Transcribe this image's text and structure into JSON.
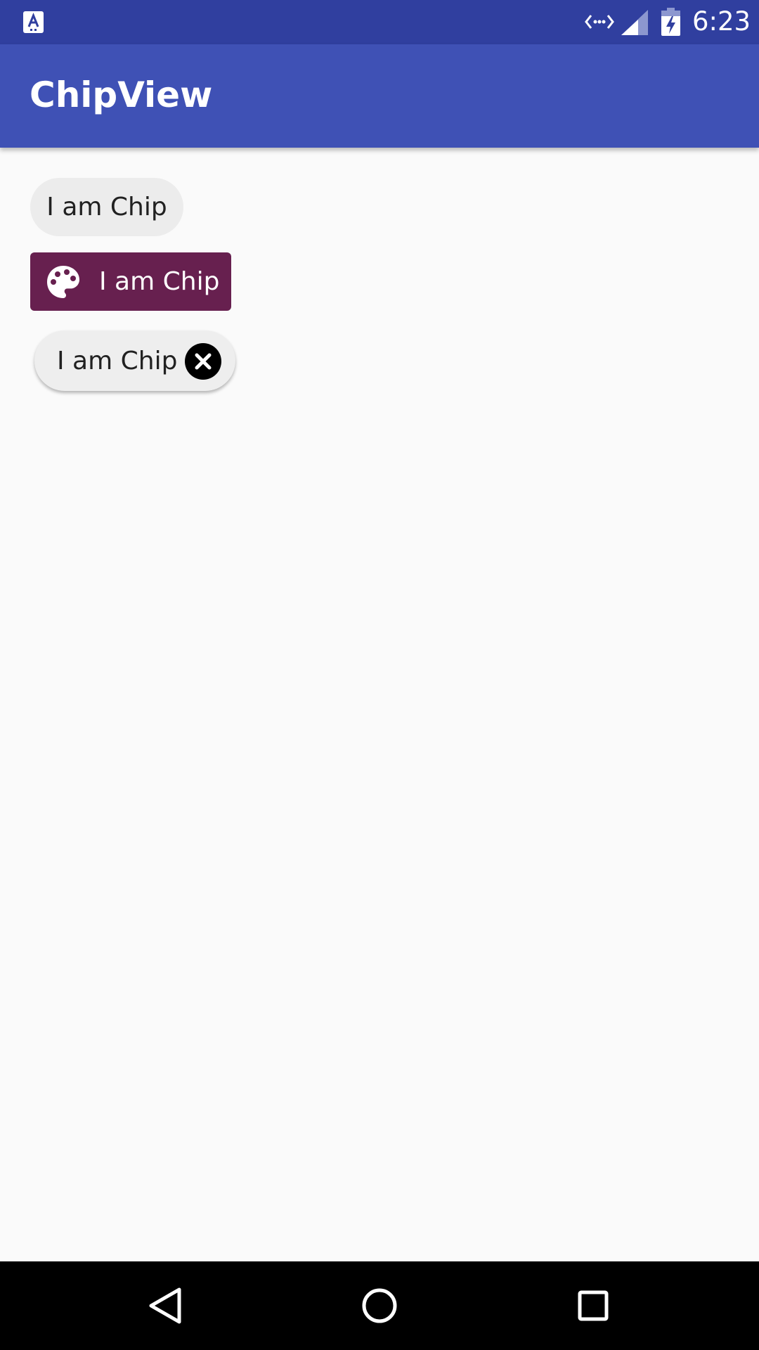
{
  "status_bar": {
    "time": "6:23",
    "icons": [
      "accessibility-a-icon",
      "data-sync-icon",
      "signal-icon",
      "battery-charging-icon"
    ],
    "background": "#303f9f"
  },
  "app_bar": {
    "title": "ChipView",
    "background": "#3f51b5"
  },
  "chips": [
    {
      "label": "I am Chip",
      "style": "plain",
      "background": "#ececec"
    },
    {
      "label": "I am Chip",
      "style": "icon",
      "icon": "palette-icon",
      "background": "#67204f",
      "text_color": "#ffffff"
    },
    {
      "label": "I am Chip",
      "style": "closable",
      "icon": "close-circle-icon",
      "background": "#eeeeee"
    }
  ],
  "nav_bar": {
    "buttons": [
      "back-icon",
      "home-icon",
      "recents-icon"
    ]
  }
}
